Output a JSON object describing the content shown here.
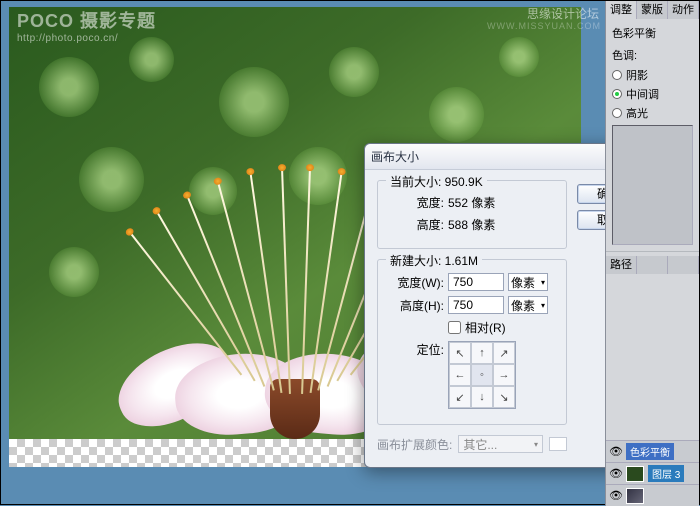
{
  "watermarks": {
    "logo": "POCO 摄影专题",
    "logo_url": "http://photo.poco.cn/",
    "top": "思缘设计论坛",
    "top_url": "WWW.MISSYUAN.COM"
  },
  "dialog": {
    "title": "画布大小",
    "close": "✕",
    "ok": "确定",
    "cancel": "取消",
    "current": {
      "legend": "当前大小: 950.9K",
      "width_label": "宽度:",
      "width_value": "552 像素",
      "height_label": "高度:",
      "height_value": "588 像素"
    },
    "new": {
      "legend": "新建大小: 1.61M",
      "width_label": "宽度(W):",
      "width_value": "750",
      "width_unit": "像素",
      "height_label": "高度(H):",
      "height_value": "750",
      "height_unit": "像素",
      "relative": "相对(R)",
      "anchor_label": "定位:"
    },
    "extend": {
      "label": "画布扩展颜色:",
      "value": "其它..."
    }
  },
  "sidebar": {
    "tabs": [
      "调整",
      "蒙版",
      "动作"
    ],
    "section_label": "色彩平衡",
    "tone_label": "色调:",
    "tones": [
      "阴影",
      "中间调",
      "高光"
    ],
    "tone_selected": 1,
    "tabs2": [
      "路径"
    ],
    "layers": {
      "adjustment": "色彩平衡",
      "layer3": "图层 3"
    }
  }
}
